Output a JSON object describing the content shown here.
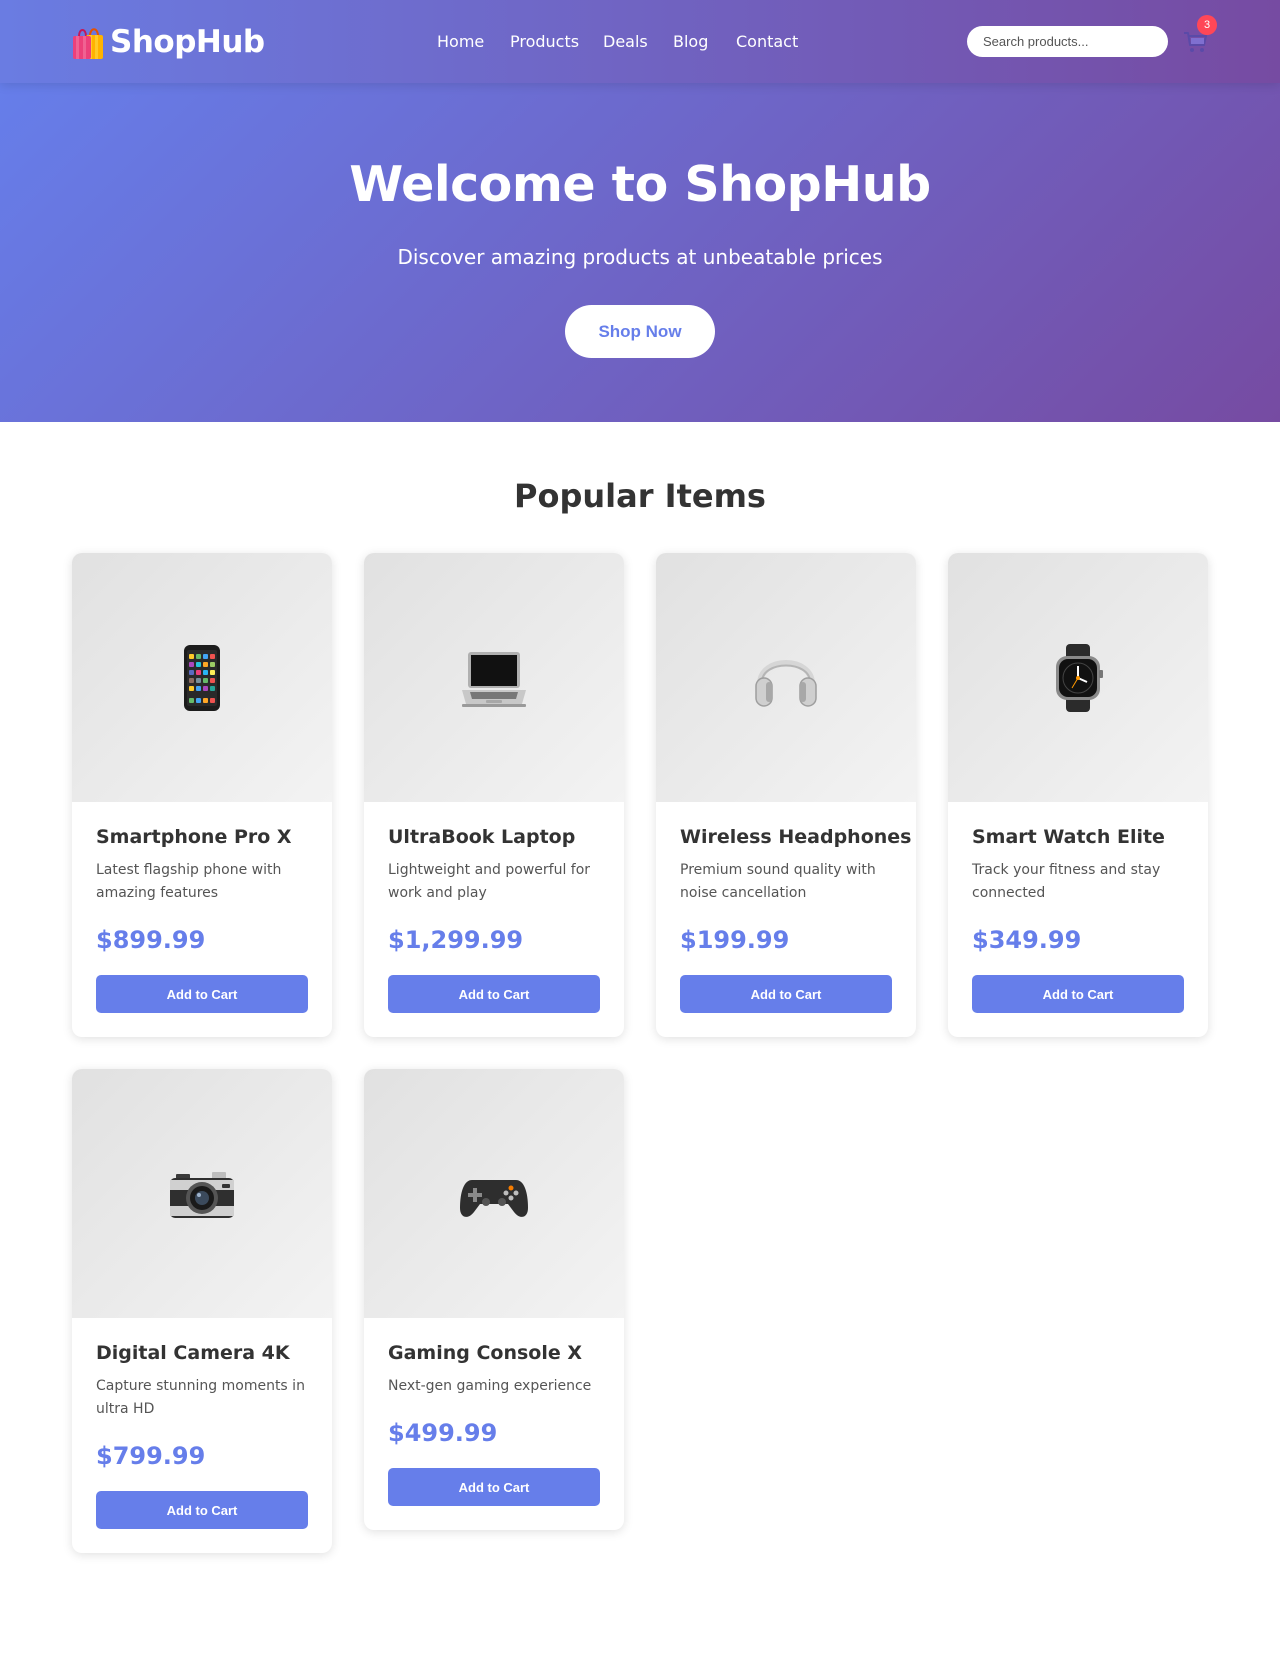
{
  "header": {
    "logo_text": "ShopHub",
    "nav": [
      "Home",
      "Products",
      "Deals",
      "Blog",
      "Contact"
    ],
    "search_placeholder": "Search products...",
    "cart_count": "3"
  },
  "hero": {
    "title": "Welcome to ShopHub",
    "subtitle": "Discover amazing products at unbeatable prices",
    "cta": "Shop Now"
  },
  "products_section": {
    "title": "Popular Items",
    "add_to_cart_label": "Add to Cart"
  },
  "products": [
    {
      "name": "Smartphone Pro X",
      "description": "Latest flagship phone with amazing features",
      "price": "$899.99",
      "icon": "smartphone-icon"
    },
    {
      "name": "UltraBook Laptop",
      "description": "Lightweight and powerful for work and play",
      "price": "$1,299.99",
      "icon": "laptop-icon"
    },
    {
      "name": "Wireless Headphones",
      "description": "Premium sound quality with noise cancellation",
      "price": "$199.99",
      "icon": "headphones-icon"
    },
    {
      "name": "Smart Watch Elite",
      "description": "Track your fitness and stay connected",
      "price": "$349.99",
      "icon": "watch-icon"
    },
    {
      "name": "Digital Camera 4K",
      "description": "Capture stunning moments in ultra HD",
      "price": "$799.99",
      "icon": "camera-icon"
    },
    {
      "name": "Gaming Console X",
      "description": "Next-gen gaming experience",
      "price": "$499.99",
      "icon": "gamepad-icon"
    }
  ],
  "colors": {
    "gradient_start": "#667eea",
    "gradient_end": "#764ba2",
    "accent": "#667eea",
    "badge": "#ff4757"
  }
}
